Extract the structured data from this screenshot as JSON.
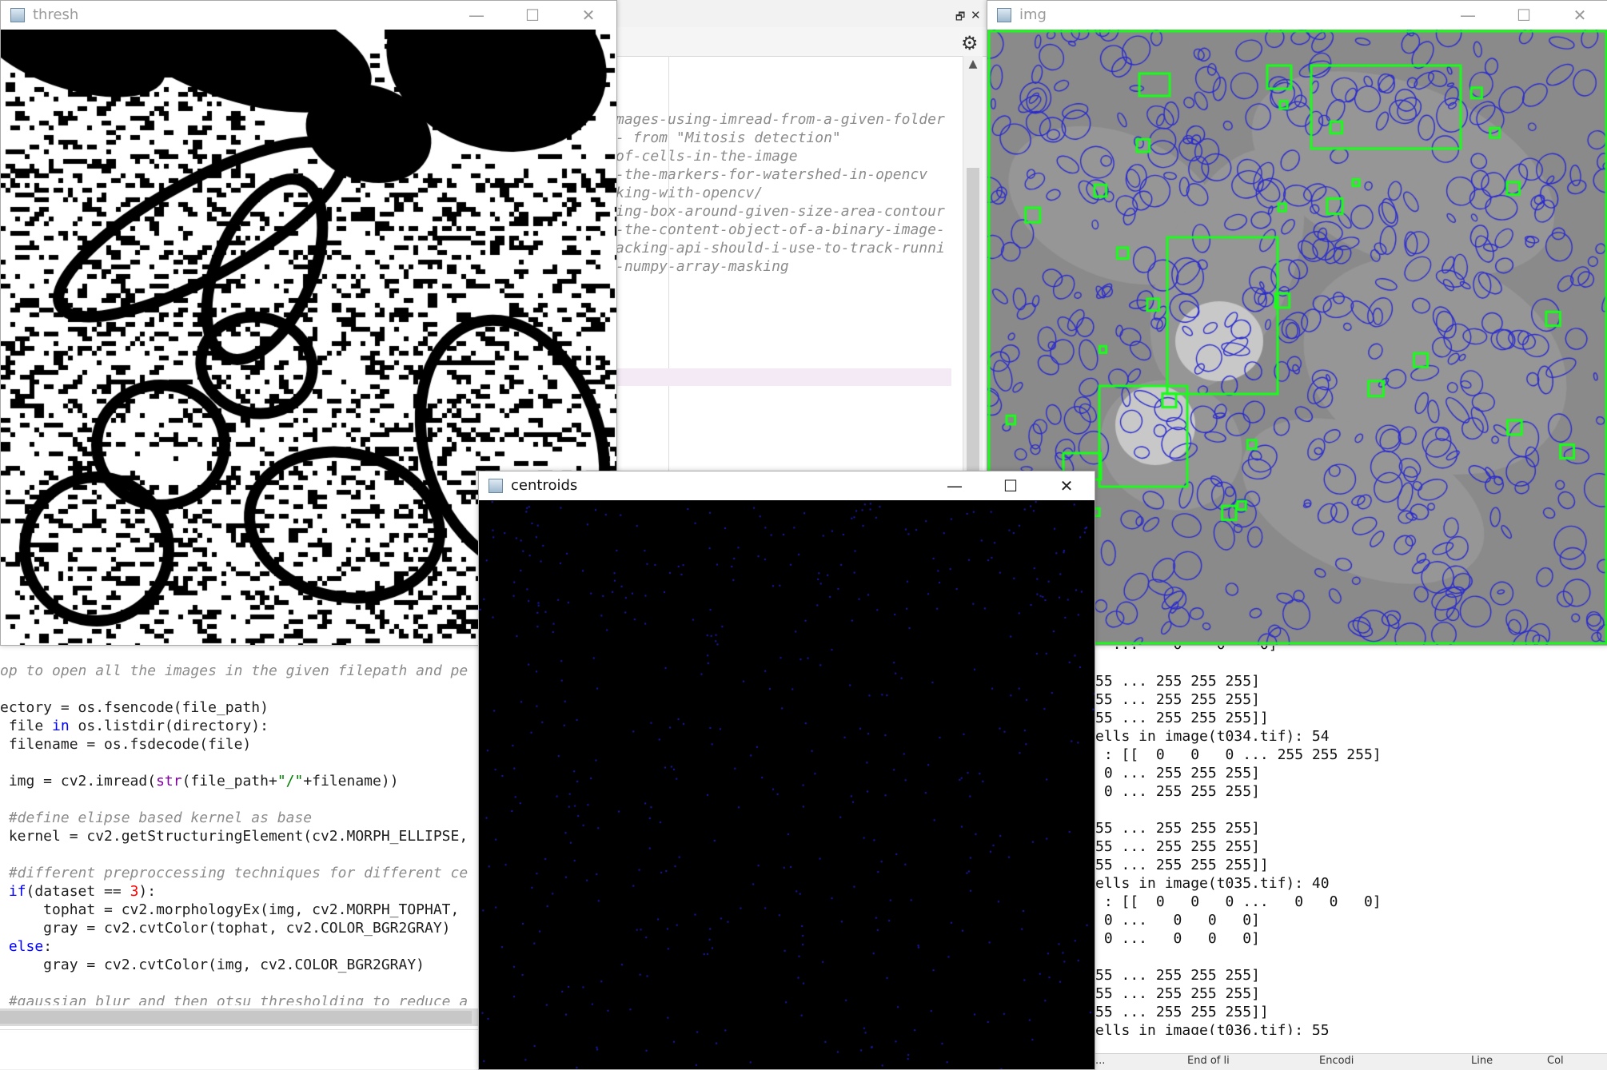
{
  "editor": {
    "url_lines": [
      "mages-using-imread-from-a-given-folder",
      "- from \"Mitosis detection\"",
      "of-cells-in-the-image",
      "-the-markers-for-watershed-in-opencv",
      "king-with-opencv/",
      "ing-box-around-given-size-area-contour",
      "-the-content-object-of-a-binary-image-",
      "acking-api-should-i-use-to-track-runni",
      "-numpy-array-masking"
    ],
    "code": {
      "l1": "op to open all the images in the given filepath and pe",
      "l3": "ectory = os.fsencode(file_path)",
      "l4a": " file ",
      "l4b": "in",
      "l4c": " os.listdir(directory):",
      "l5": " filename = os.fsdecode(file)",
      "l7a": " img = cv2.imread(",
      "l7b": "str",
      "l7c": "(file_path+",
      "l7d": "\"/\"",
      "l7e": "+filename))",
      "l9": " #define elipse based kernel as base",
      "l10": " kernel = cv2.getStructuringElement(cv2.MORPH_ELLIPSE,",
      "l12": " #different preproccessing techniques for different ce",
      "l13a": " if",
      "l13b": "(dataset == ",
      "l13c": "3",
      "l13d": "):",
      "l14": "     tophat = cv2.morphologyEx(img, cv2.MORPH_TOPHAT, ",
      "l15": "     gray = cv2.cvtColor(tophat, cv2.COLOR_BGR2GRAY)",
      "l16a": " else",
      "l16b": ":",
      "l17": "     gray = cv2.cvtColor(img, cv2.COLOR_BGR2GRAY)",
      "l19": " #gaussian blur and then otsu thresholding to reduce a"
    },
    "console_lines": [
      "  ...    0    0    0]",
      "",
      "55 ... 255 255 255]",
      "55 ... 255 255 255]",
      "55 ... 255 255 255]]",
      "ells in image(t034.tif): 54",
      " : [[  0   0   0 ... 255 255 255]",
      " 0 ... 255 255 255]",
      " 0 ... 255 255 255]",
      "",
      "55 ... 255 255 255]",
      "55 ... 255 255 255]",
      "55 ... 255 255 255]]",
      "ells in image(t035.tif): 40",
      " : [[  0   0   0 ...   0   0   0]",
      " 0 ...   0   0   0]",
      " 0 ...   0   0   0]",
      "",
      "55 ... 255 255 255]",
      "55 ... 255 255 255]",
      "55 ... 255 255 255]]",
      "ells in image(t036.tif): 55"
    ],
    "status": {
      "s1": "... ",
      "s2": "End of li",
      "s3": "Encodi",
      "s4": "Line",
      "s5": "Col"
    }
  },
  "windows": {
    "thresh": {
      "title": "thresh"
    },
    "img": {
      "title": "img"
    },
    "centroids": {
      "title": "centroids"
    },
    "buttons": {
      "minimize": "—",
      "maximize": "☐",
      "close": "✕"
    }
  },
  "icons": {
    "gear": "⚙",
    "restore": "🗗",
    "close_small": "✕",
    "scroll_up": "▲"
  },
  "colors": {
    "keyword": "#0000ff",
    "builtin": "#8000a0",
    "string": "#007f00",
    "number": "#ff0000",
    "comment": "#8c8c8c",
    "contour_blue": "#2a2ad0",
    "bbox_green": "#18ff18"
  }
}
